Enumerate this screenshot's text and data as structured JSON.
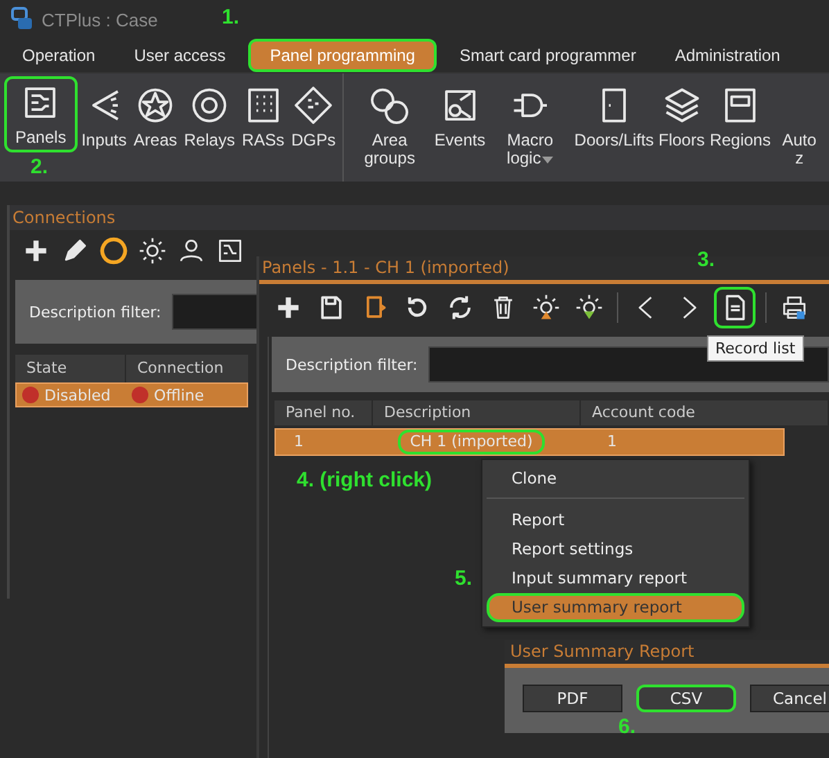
{
  "window": {
    "title": "CTPlus : Case"
  },
  "menu_tabs": [
    {
      "label": "Operation",
      "selected": false,
      "highlighted": false
    },
    {
      "label": "User access",
      "selected": false,
      "highlighted": false
    },
    {
      "label": "Panel programming",
      "selected": true,
      "highlighted": true
    },
    {
      "label": "Smart card programmer",
      "selected": false,
      "highlighted": false
    },
    {
      "label": "Administration",
      "selected": false,
      "highlighted": false
    }
  ],
  "ribbon": {
    "groups": [
      {
        "items": [
          {
            "label": "Panels",
            "highlighted": true,
            "dropdown": false
          },
          {
            "label": "Inputs",
            "highlighted": false,
            "dropdown": false
          },
          {
            "label": "Areas",
            "highlighted": false,
            "dropdown": false
          },
          {
            "label": "Relays",
            "highlighted": false,
            "dropdown": false
          },
          {
            "label": "RASs",
            "highlighted": false,
            "dropdown": false
          },
          {
            "label": "DGPs",
            "highlighted": false,
            "dropdown": false
          }
        ]
      },
      {
        "items": [
          {
            "label": "Area groups",
            "highlighted": false,
            "dropdown": false
          },
          {
            "label": "Events",
            "highlighted": false,
            "dropdown": false
          },
          {
            "label": "Macro logic",
            "highlighted": false,
            "dropdown": true
          },
          {
            "label": "Doors/Lifts",
            "highlighted": false,
            "dropdown": false
          },
          {
            "label": "Floors",
            "highlighted": false,
            "dropdown": false
          },
          {
            "label": "Regions",
            "highlighted": false,
            "dropdown": false
          },
          {
            "label": "Auto z",
            "highlighted": false,
            "dropdown": false
          }
        ]
      }
    ]
  },
  "connections": {
    "title": "Connections",
    "filter_label": "Description filter:",
    "columns": [
      "State",
      "Connection"
    ],
    "rows": [
      {
        "selected": true,
        "cells": [
          {
            "text": "Disabled",
            "color": "#c0302a"
          },
          {
            "text": "Offline",
            "color": "#c0302a"
          }
        ]
      }
    ]
  },
  "panels": {
    "title": "Panels - 1.1 - CH 1 (imported)",
    "toolbar": [
      {
        "highlighted": false
      },
      {
        "highlighted": false
      },
      {
        "highlighted": false
      },
      {
        "highlighted": false
      },
      {
        "highlighted": false
      },
      {
        "highlighted": false
      },
      {
        "highlighted": false
      },
      {
        "highlighted": false
      },
      {
        "highlighted": false
      },
      {
        "highlighted": false
      },
      {
        "highlighted": true
      },
      {
        "highlighted": false
      }
    ],
    "tooltip": "Record list",
    "filter_label": "Description filter:",
    "columns": [
      "Panel no.",
      "Description",
      "Account code"
    ],
    "rows": [
      {
        "selected": true,
        "cells": [
          {
            "text": "1",
            "highlighted": false
          },
          {
            "text": "CH 1 (imported)",
            "highlighted": true
          },
          {
            "text": "1",
            "highlighted": false
          }
        ]
      }
    ]
  },
  "context_menu": {
    "items": [
      {
        "label": "Clone",
        "selected": false,
        "highlighted": false,
        "separator_after": true
      },
      {
        "label": "Report",
        "selected": false,
        "highlighted": false,
        "separator_after": false
      },
      {
        "label": "Report settings",
        "selected": false,
        "highlighted": false,
        "separator_after": false
      },
      {
        "label": "Input summary report",
        "selected": false,
        "highlighted": false,
        "separator_after": false
      },
      {
        "label": "User summary report",
        "selected": true,
        "highlighted": true,
        "separator_after": false
      }
    ]
  },
  "dialog": {
    "title": "User Summary Report",
    "buttons": [
      {
        "label": "PDF",
        "default": false,
        "highlighted": false
      },
      {
        "label": "CSV",
        "default": true,
        "highlighted": true
      },
      {
        "label": "Cancel",
        "default": false,
        "highlighted": false
      }
    ]
  },
  "steps": [
    {
      "label": "1."
    },
    {
      "label": "2."
    },
    {
      "label": "3."
    },
    {
      "label": "4. (right click)"
    },
    {
      "label": "5."
    },
    {
      "label": "6."
    }
  ]
}
